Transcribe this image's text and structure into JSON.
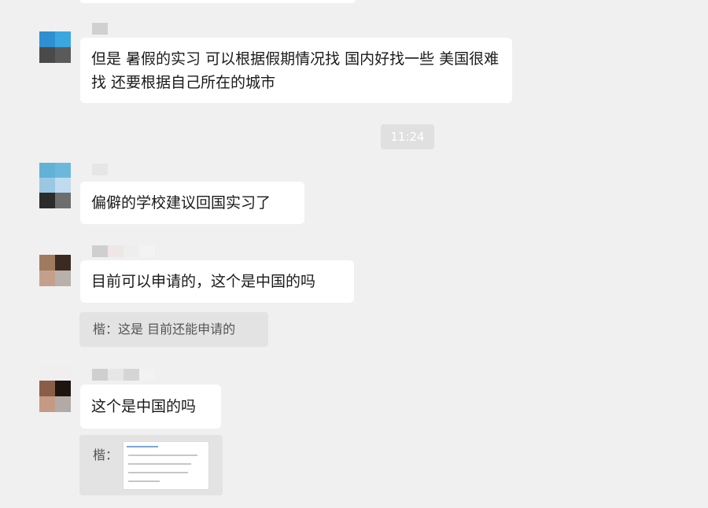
{
  "chat": {
    "messages": [
      {
        "text": "但是 暑假的实习  可以根据假期情况找 国内好找一些 美国很难找 还要根据自己所在的城市"
      },
      {
        "text": "偏僻的学校建议回国实习了"
      },
      {
        "text": "目前可以申请的，这个是中国的吗"
      },
      {
        "text": "这个是中国的吗"
      }
    ],
    "timestamp": "11:24",
    "quotes": [
      {
        "text": "楷：这是 目前还能申请的"
      },
      {
        "text": "楷："
      }
    ]
  }
}
